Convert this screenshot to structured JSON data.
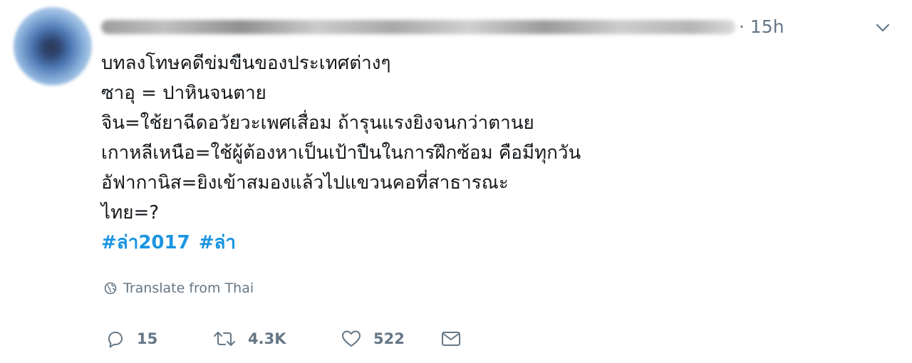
{
  "header": {
    "time": "· 15h",
    "caret_icon": "chevron-down-icon"
  },
  "tweet": {
    "lines": [
      "บทลงโทษคดีข่มขืนของประเทศต่างๆ",
      "ซาอุ = ปาหินจนตาย",
      "จิน=ใช้ยาฉีดอวัยวะเพศเสื่อม ถ้ารุนแรงยิงจนกว่าตานย",
      "เกาหลีเหนือ=ใช้ผู้ต้องหาเป็นเป้าปืนในการฝึกซ้อม คือมีทุกวัน",
      "อัฟากานิส=ยิงเข้าสมองแล้วไปแขวนคอที่สาธารณะ",
      "ไทย=?"
    ],
    "hashtags": [
      "#ล่า2017",
      "#ล่า"
    ]
  },
  "translate": {
    "label": "Translate from Thai",
    "icon": "globe-icon"
  },
  "actions": {
    "reply_count": "15",
    "retweet_count": "4.3K",
    "like_count": "522",
    "icons": [
      "reply-icon",
      "retweet-icon",
      "heart-icon",
      "message-icon"
    ]
  },
  "colors": {
    "text": "#14171a",
    "secondary": "#657786",
    "link": "#1b95e0"
  }
}
